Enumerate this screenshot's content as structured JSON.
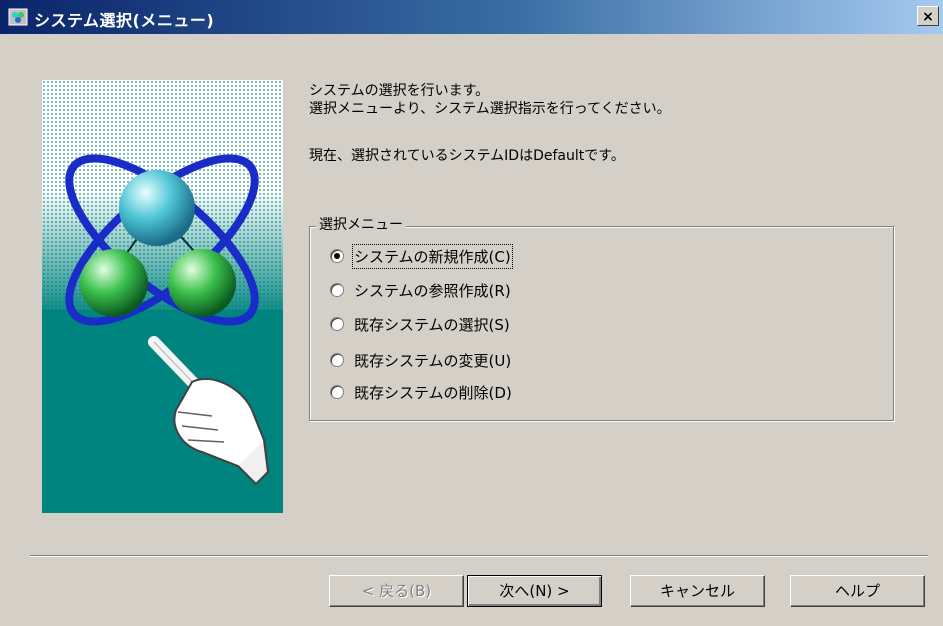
{
  "window": {
    "title": "システム選択(メニュー)",
    "close_label": "×"
  },
  "instructions": {
    "line1": "システムの選択を行います。",
    "line2": "選択メニューより、システム選択指示を行ってください。",
    "line3": "現在、選択されているシステムIDはDefaultです。"
  },
  "menu": {
    "legend": "選択メニュー",
    "options": [
      {
        "label": "システムの新規作成(C)",
        "selected": true
      },
      {
        "label": "システムの参照作成(R)",
        "selected": false
      },
      {
        "label": "既存システムの選択(S)",
        "selected": false
      },
      {
        "label": "既存システムの変更(U)",
        "selected": false
      },
      {
        "label": "既存システムの削除(D)",
        "selected": false
      }
    ]
  },
  "buttons": {
    "back": "< 戻る(B)",
    "next": "次へ(N) >",
    "cancel": "キャンセル",
    "help": "ヘルプ"
  },
  "colors": {
    "titlebar_start": "#0a246a",
    "titlebar_end": "#a6caf0",
    "dialog_bg": "#d4d0c8",
    "panel_teal": "#00847f"
  }
}
